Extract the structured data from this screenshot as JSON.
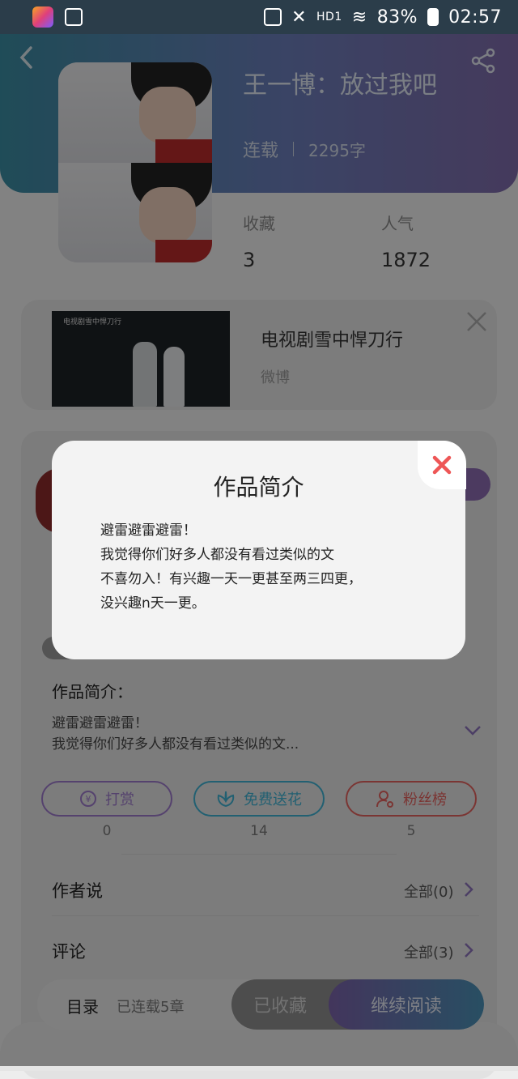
{
  "status_bar": {
    "network": "HD1",
    "battery": "83%",
    "time": "02:57"
  },
  "book": {
    "title": "王一博：放过我吧",
    "status": "连载",
    "word_count": "2295字",
    "stats": [
      {
        "label": "收藏",
        "value": "3"
      },
      {
        "label": "人气",
        "value": "1872"
      }
    ]
  },
  "video": {
    "thumb_caption": "电视剧雪中悍刀行",
    "title": "电视剧雪中悍刀行",
    "source": "微博"
  },
  "intro": {
    "label": "作品简介：",
    "line1": "避雷避雷避雷！",
    "line2": "我觉得你们好多人都没有看过类似的文..."
  },
  "actions": [
    {
      "label": "打赏",
      "count": "0",
      "color": "#9b79c8"
    },
    {
      "label": "免费送花",
      "count": "14",
      "color": "#3fb0cf"
    },
    {
      "label": "粉丝榜",
      "count": "5",
      "color": "#e0625e"
    }
  ],
  "author_says": {
    "title": "作者说",
    "all": "全部(0)"
  },
  "comments": {
    "title": "评论",
    "all": "全部(3)"
  },
  "bottom_bar": {
    "toc": "目录",
    "chapters": "已连载5章",
    "favorited": "已收藏",
    "continue": "继续阅读"
  },
  "modal": {
    "title": "作品简介",
    "lines": [
      "避雷避雷避雷！",
      "我觉得你们好多人都没有看过类似的文",
      "不喜勿入！有兴趣一天一更甚至两三四更，",
      "没兴趣n天一更。"
    ],
    "close_color": "#ee5656"
  }
}
